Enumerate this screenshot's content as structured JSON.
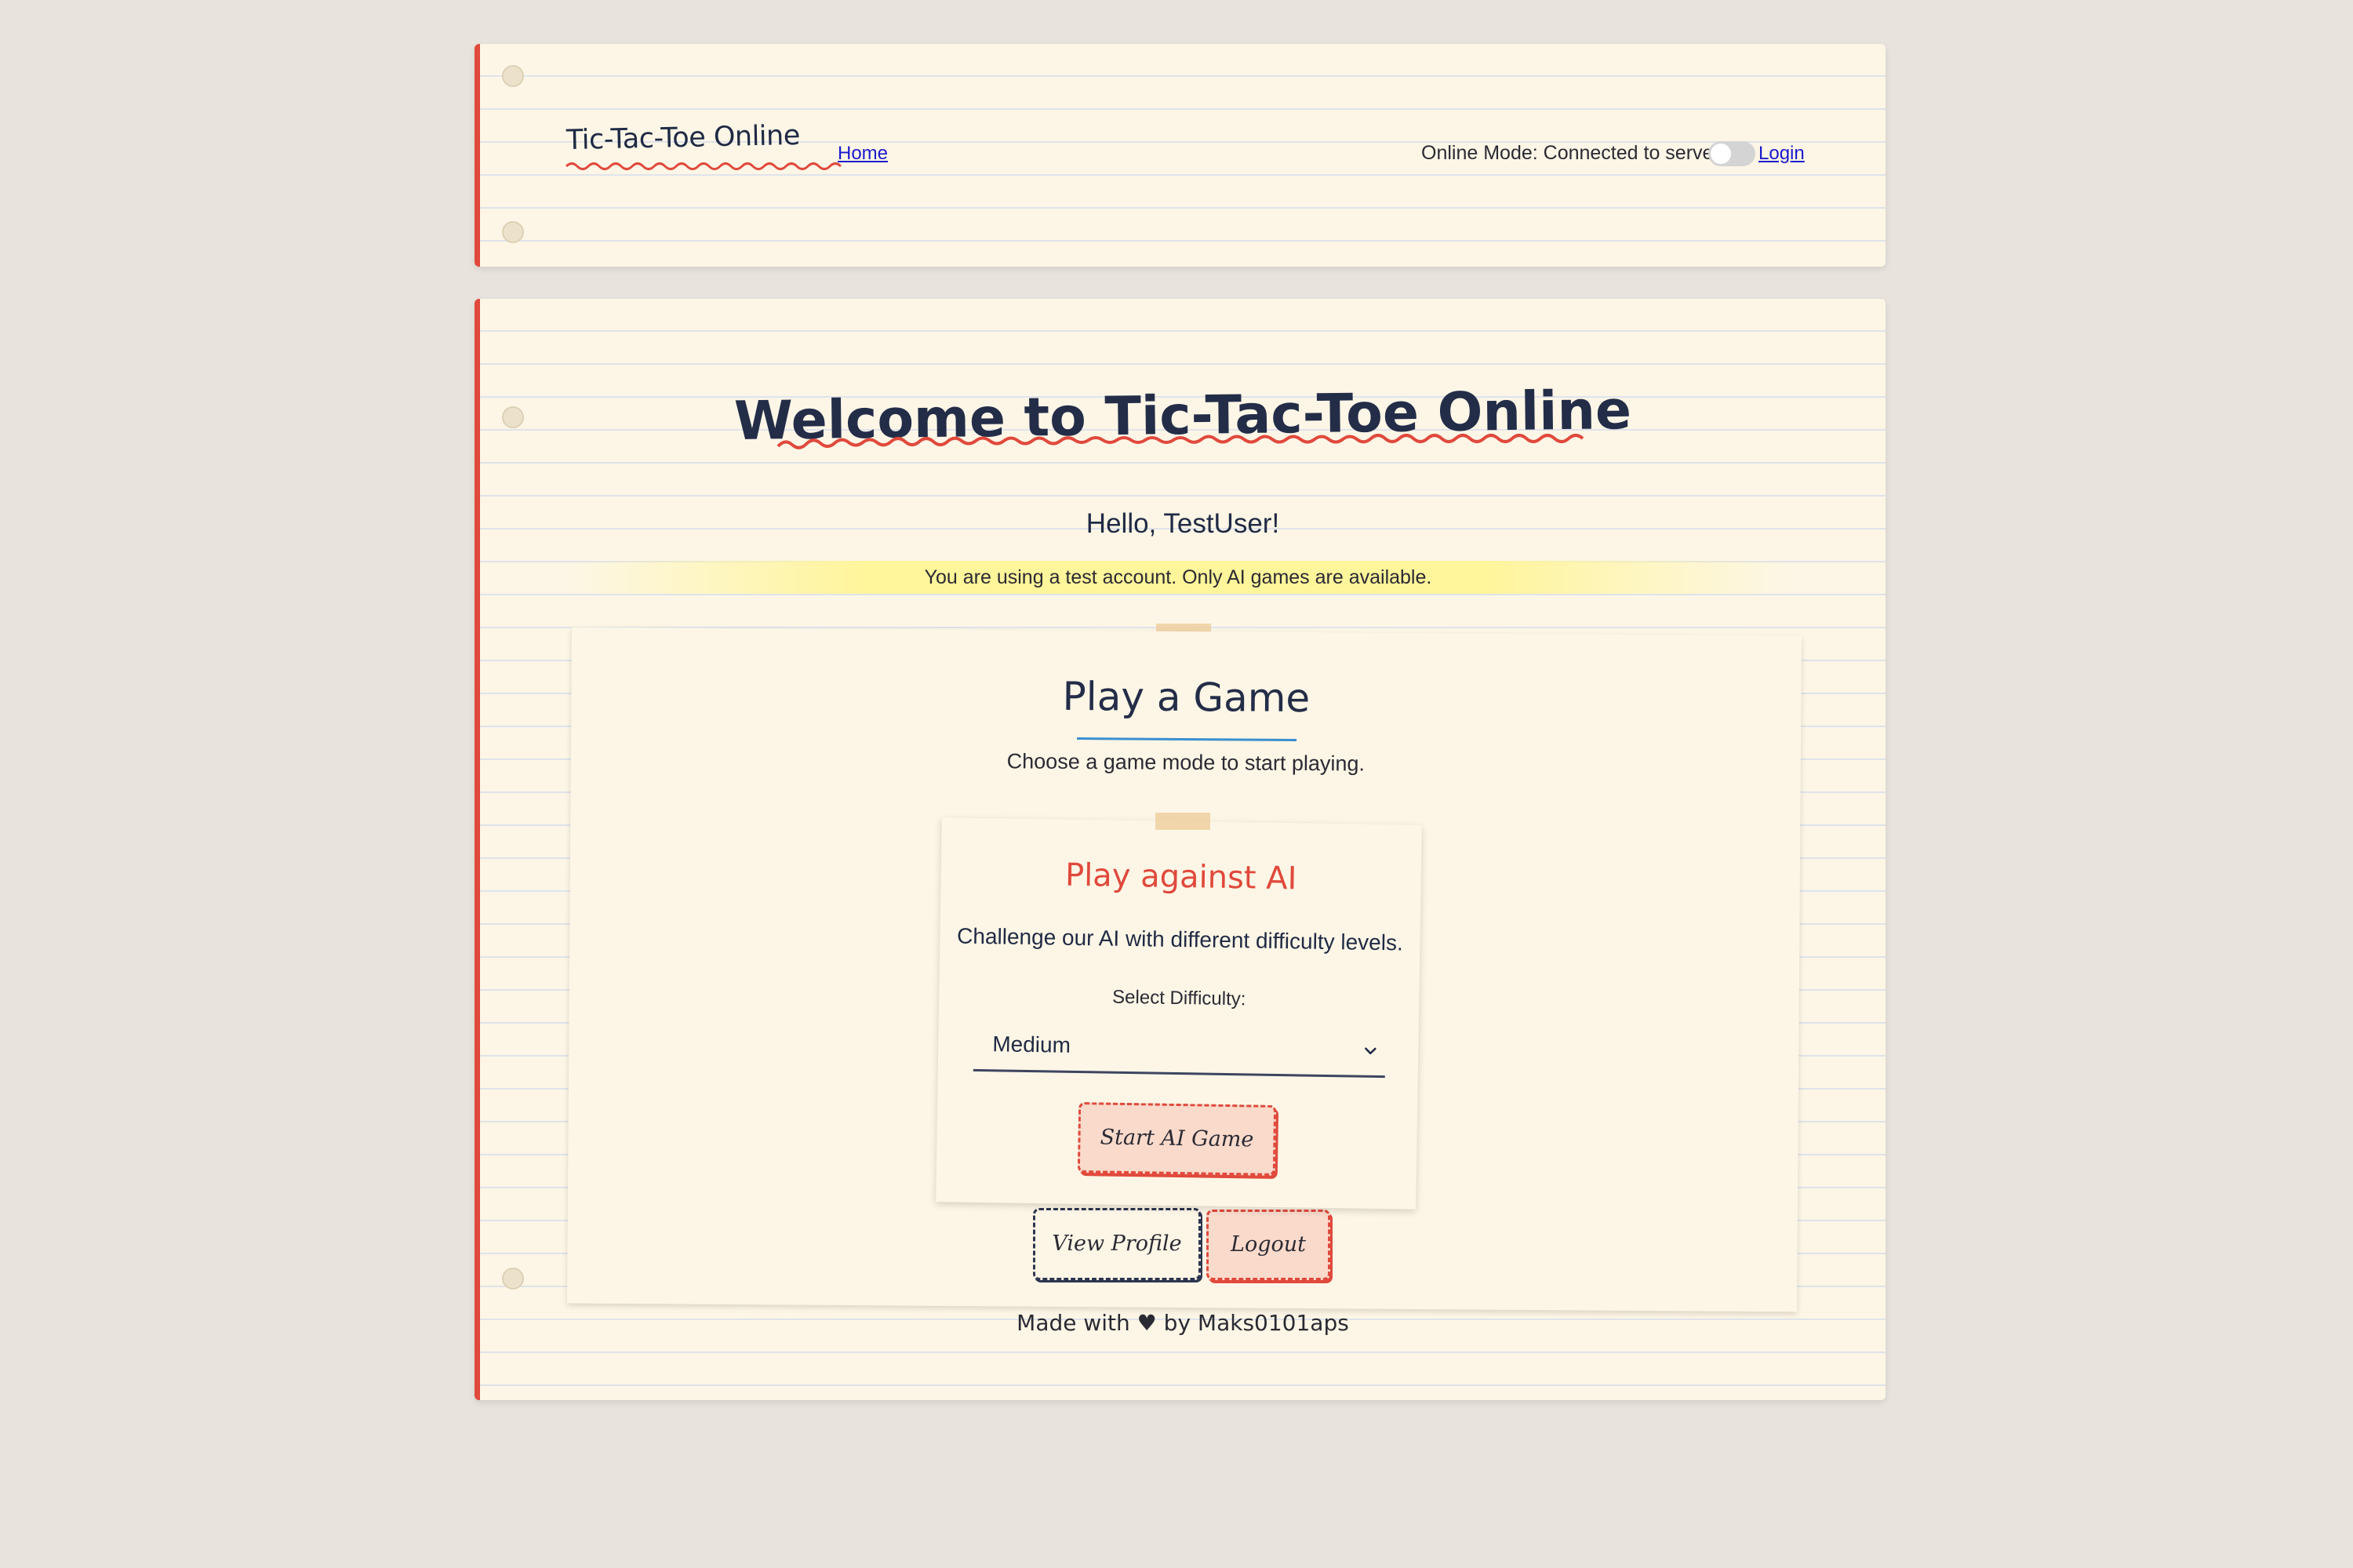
{
  "header": {
    "brand": "Tic-Tac-Toe Online",
    "nav_home": "Home",
    "status": "Online Mode: Connected to server",
    "login": "Login"
  },
  "main": {
    "welcome": "Welcome to Tic-Tac-Toe Online",
    "greeting": "Hello, TestUser!",
    "notice": "You are using a test account. Only AI games are available.",
    "play_title": "Play a Game",
    "play_subtitle": "Choose a game mode to start playing.",
    "ai_card": {
      "title": "Play against AI",
      "description": "Challenge our AI with different difficulty levels.",
      "difficulty_label": "Select Difficulty:",
      "difficulty_value": "Medium",
      "start_button": "Start AI Game"
    },
    "view_profile_button": "View Profile",
    "logout_button": "Logout",
    "footer": "Made with ♥ by Maks0101aps"
  },
  "colors": {
    "background": "#e8e3dd",
    "paper": "#fdf6e6",
    "accent_red": "#e0493c",
    "ink": "#1f2a44",
    "highlight_yellow": "#fff59a",
    "link_blue": "#1a1acc"
  },
  "icons": [
    "chevron-down-icon"
  ]
}
